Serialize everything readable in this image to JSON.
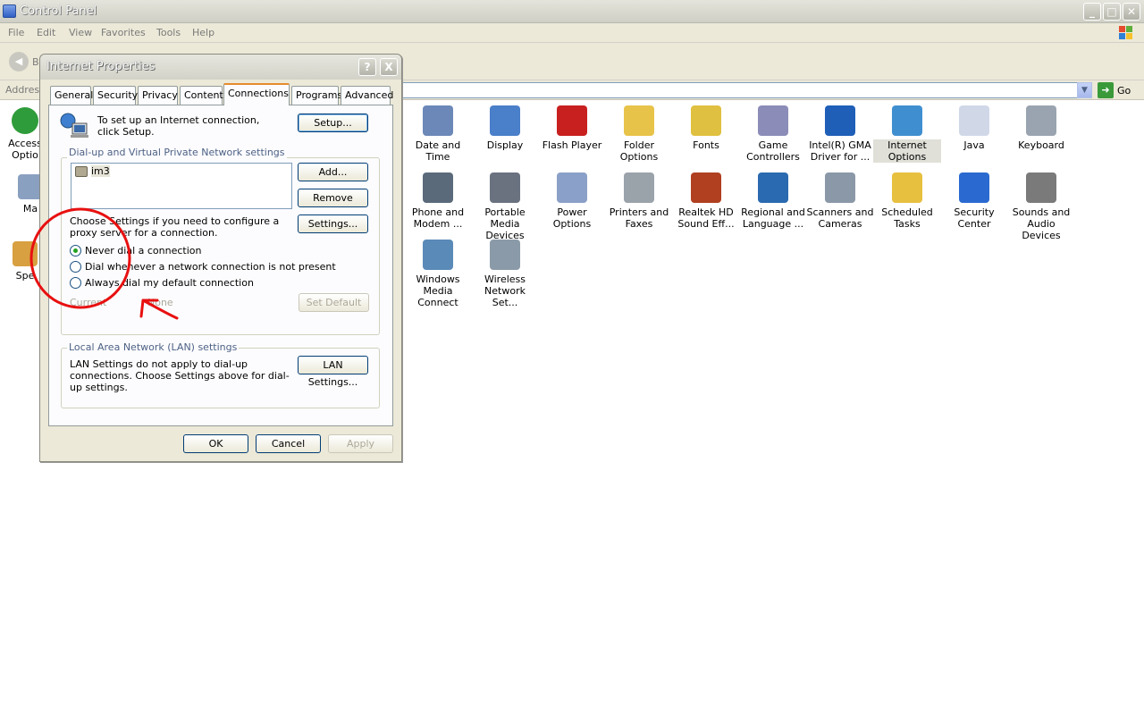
{
  "window": {
    "title": "Control Panel"
  },
  "menu": [
    "File",
    "Edit",
    "View",
    "Favorites",
    "Tools",
    "Help"
  ],
  "toolbar": {
    "back_label": "B"
  },
  "address": {
    "label": "Address",
    "go_label": "Go"
  },
  "left_icons": [
    {
      "label": "Access Optio"
    },
    {
      "label": "Ma"
    },
    {
      "label": "Spe"
    }
  ],
  "control_panel_items": [
    {
      "label": "Date and Time",
      "color": "#6b88b8"
    },
    {
      "label": "Display",
      "color": "#4a7fc9"
    },
    {
      "label": "Flash Player",
      "color": "#c81f1f"
    },
    {
      "label": "Folder Options",
      "color": "#e8c34a"
    },
    {
      "label": "Fonts",
      "color": "#e0c040"
    },
    {
      "label": "Game Controllers",
      "color": "#8c8cb8"
    },
    {
      "label": "Intel(R) GMA Driver for ...",
      "color": "#1f5fb8"
    },
    {
      "label": "Internet Options",
      "color": "#3f8fd0"
    },
    {
      "label": "Java",
      "color": "#d0d8e8"
    },
    {
      "label": "Keyboard",
      "color": "#9aa4b0"
    },
    {
      "label": "Phone and Modem ...",
      "color": "#5a6a7a"
    },
    {
      "label": "Portable Media Devices",
      "color": "#6a7280"
    },
    {
      "label": "Power Options",
      "color": "#8aa0c8"
    },
    {
      "label": "Printers and Faxes",
      "color": "#9aa2aa"
    },
    {
      "label": "Realtek HD Sound Eff...",
      "color": "#b04020"
    },
    {
      "label": "Regional and Language ...",
      "color": "#2a6ab0"
    },
    {
      "label": "Scanners and Cameras",
      "color": "#8a98a8"
    },
    {
      "label": "Scheduled Tasks",
      "color": "#e8c040"
    },
    {
      "label": "Security Center",
      "color": "#2a6ad0"
    },
    {
      "label": "Sounds and Audio Devices",
      "color": "#7a7a7a"
    },
    {
      "label": "Windows Media Connect",
      "color": "#5a8ab8"
    },
    {
      "label": "Wireless Network Set...",
      "color": "#8a9aa8"
    }
  ],
  "dialog": {
    "title": "Internet Properties",
    "help_button": "?",
    "close_button": "X",
    "tabs": [
      "General",
      "Security",
      "Privacy",
      "Content",
      "Connections",
      "Programs",
      "Advanced"
    ],
    "active_tab": "Connections",
    "setup_text": "To set up an Internet connection, click Setup.",
    "setup_button": "Setup...",
    "dialup_group_label": "Dial-up and Virtual Private Network settings",
    "connections": [
      "im3"
    ],
    "add_button": "Add...",
    "remove_button": "Remove",
    "proxy_text": "Choose Settings if you need to configure a proxy server for a connection.",
    "settings_button": "Settings...",
    "radio_options": [
      {
        "label": "Never dial a connection",
        "checked": true
      },
      {
        "label": "Dial whenever a network connection is not present",
        "checked": false
      },
      {
        "label": "Always dial my default connection",
        "checked": false
      }
    ],
    "current_label": "Current",
    "current_value": "None",
    "set_default_button": "Set Default",
    "lan_group_label": "Local Area Network (LAN) settings",
    "lan_text": "LAN Settings do not apply to dial-up connections. Choose Settings above for dial-up settings.",
    "lan_button": "LAN Settings...",
    "ok_button": "OK",
    "cancel_button": "Cancel",
    "apply_button": "Apply"
  },
  "annotation_color": "#e81010"
}
